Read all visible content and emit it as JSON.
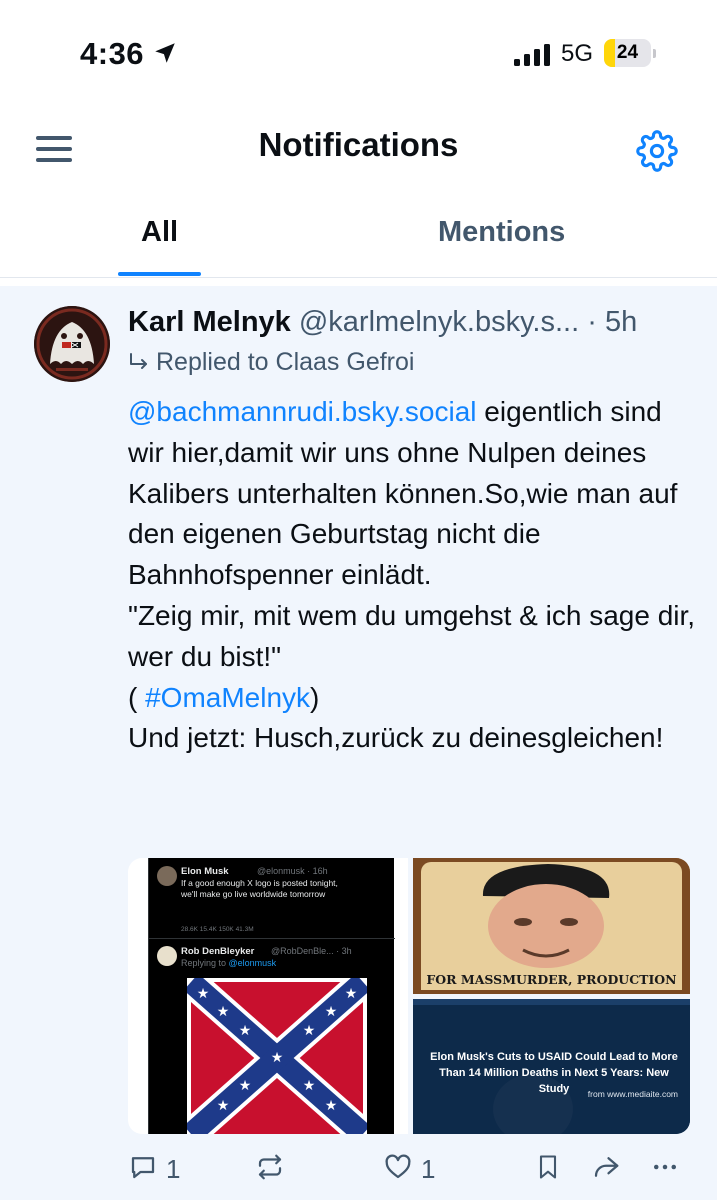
{
  "status_bar": {
    "time": "4:36",
    "network": "5G",
    "battery_percent": "24",
    "battery_level": 0.24
  },
  "header": {
    "title": "Notifications"
  },
  "tabs": [
    {
      "label": "All",
      "active": true
    },
    {
      "label": "Mentions",
      "active": false
    }
  ],
  "notification": {
    "author_name": "Karl Melnyk",
    "author_handle": "@karlmelnyk.bsky.s...",
    "separator": "·",
    "time": "5h",
    "reply_label": "Replied to Claas Gefroi",
    "text": {
      "mention": "@bachmannrudi.bsky.social",
      "part1": " eigentlich sind wir hier,damit wir uns ohne Nulpen deines Kalibers unterhalten können.So,wie man auf den eigenen Geburtstag nicht die Bahnhofspenner einlädt.",
      "part2": "\"Zeig mir, mit wem du umgehst & ich sage dir, wer du bist!\"",
      "paren_open": "( ",
      "hashtag": "#OmaMelnyk",
      "paren_close": ")",
      "part3": "Und jetzt: Husch,zurück zu deinesgleichen!"
    },
    "images": {
      "tweet": {
        "name1": "Elon Musk",
        "handle1": "@elonmusk · 16h",
        "text1": "If a good enough X logo is posted tonight, we'll make go live worldwide tomorrow",
        "stats": "28.6K    15.4K    150K    41.3M",
        "name2": "Rob DenBleyker",
        "handle2": "@RobDenBle... · 3h",
        "replying_prefix": "Replying to ",
        "replying_handle": "@elonmusk"
      },
      "meme": {
        "caption": "FOR MASSMURDER, PRODUCTION"
      },
      "news": {
        "headline": "Elon Musk's Cuts to USAID Could Lead to More Than 14 Million Deaths in Next 5 Years: New Study",
        "source": "from www.mediaite.com"
      }
    },
    "actions": {
      "reply_count": "1",
      "like_count": "1"
    }
  },
  "colors": {
    "accent": "#1083fe",
    "muted": "#42576c",
    "card_background": "#f1f6fd"
  }
}
